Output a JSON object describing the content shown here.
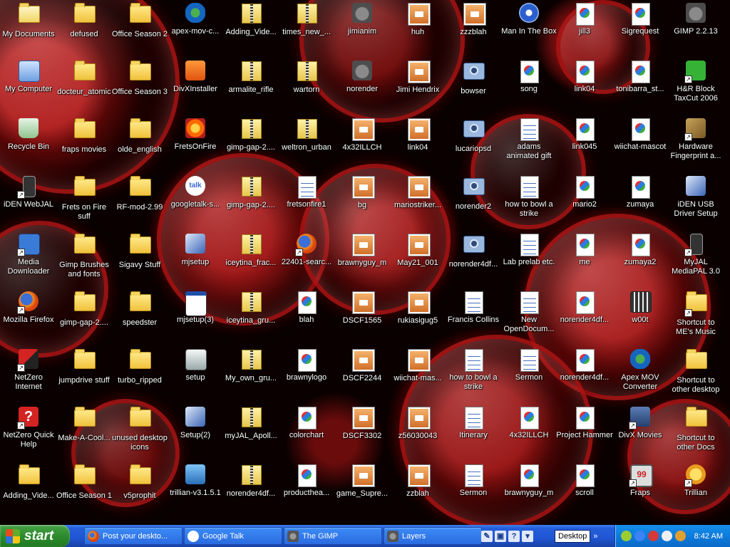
{
  "desktop": {
    "icons": [
      {
        "label": "My Documents",
        "type": "mydocs",
        "col": 0,
        "row": 0
      },
      {
        "label": "defused",
        "type": "folder",
        "col": 1,
        "row": 0
      },
      {
        "label": "Office Season 2",
        "type": "folder",
        "col": 2,
        "row": 0
      },
      {
        "label": "apex-mov-c...",
        "type": "apex",
        "col": 3,
        "row": 0
      },
      {
        "label": "Adding_Vide...",
        "type": "zip",
        "col": 4,
        "row": 0
      },
      {
        "label": "times_new_...",
        "type": "zip",
        "col": 5,
        "row": 0
      },
      {
        "label": "jimianim",
        "type": "gimp",
        "col": 6,
        "row": 0
      },
      {
        "label": "huh",
        "type": "gimpimg",
        "col": 7,
        "row": 0
      },
      {
        "label": "zzzblah",
        "type": "gimpimg",
        "col": 8,
        "row": 0
      },
      {
        "label": "Man In The Box",
        "type": "media",
        "col": 9,
        "row": 0
      },
      {
        "label": "jill3",
        "type": "doc",
        "col": 10,
        "row": 0
      },
      {
        "label": "Sigrequest",
        "type": "doc",
        "col": 11,
        "row": 0
      },
      {
        "label": "GIMP 2.2.13",
        "type": "gimp",
        "col": 12,
        "row": 0
      },
      {
        "label": "My Computer",
        "type": "mycomp",
        "col": 0,
        "row": 1
      },
      {
        "label": "docteur_atomic",
        "type": "folder",
        "col": 1,
        "row": 1
      },
      {
        "label": "Office Season 3",
        "type": "folder",
        "col": 2,
        "row": 1
      },
      {
        "label": "DivXInstaller",
        "type": "divx",
        "col": 3,
        "row": 1
      },
      {
        "label": "armalite_rifle",
        "type": "zip",
        "col": 4,
        "row": 1
      },
      {
        "label": "wartorn",
        "type": "zip",
        "col": 5,
        "row": 1
      },
      {
        "label": "norender",
        "type": "gimp",
        "col": 6,
        "row": 1
      },
      {
        "label": "Jimi Hendrix",
        "type": "gimpimg",
        "col": 7,
        "row": 1
      },
      {
        "label": "bowser",
        "type": "cam",
        "col": 8,
        "row": 1
      },
      {
        "label": "song",
        "type": "mp3",
        "col": 9,
        "row": 1
      },
      {
        "label": "link04",
        "type": "doc",
        "col": 10,
        "row": 1
      },
      {
        "label": "tonibarra_st...",
        "type": "doc",
        "col": 11,
        "row": 1
      },
      {
        "label": "H&R Block TaxCut 2006",
        "type": "hrblock",
        "col": 12,
        "row": 1
      },
      {
        "label": "Recycle Bin",
        "type": "recycle",
        "col": 0,
        "row": 2
      },
      {
        "label": "fraps movies",
        "type": "folder",
        "col": 1,
        "row": 2
      },
      {
        "label": "olde_english",
        "type": "folder",
        "col": 2,
        "row": 2
      },
      {
        "label": "FretsOnFire",
        "type": "frets",
        "col": 3,
        "row": 2
      },
      {
        "label": "gimp-gap-2....",
        "type": "zip",
        "col": 4,
        "row": 2
      },
      {
        "label": "weltron_urban",
        "type": "zip",
        "col": 5,
        "row": 2
      },
      {
        "label": "4x32ILLCH",
        "type": "gimpimg",
        "col": 6,
        "row": 2
      },
      {
        "label": "link04",
        "type": "gimpimg",
        "col": 7,
        "row": 2
      },
      {
        "label": "lucariopsd",
        "type": "cam",
        "col": 8,
        "row": 2
      },
      {
        "label": "adams animated gift",
        "type": "textdoc",
        "col": 9,
        "row": 2
      },
      {
        "label": "link045",
        "type": "doc",
        "col": 10,
        "row": 2
      },
      {
        "label": "wiichat-mascot",
        "type": "doc",
        "col": 11,
        "row": 2
      },
      {
        "label": "Hardware Fingerprint a...",
        "type": "tools",
        "col": 12,
        "row": 2
      },
      {
        "label": "iDEN WebJAL",
        "type": "phone",
        "col": 0,
        "row": 3
      },
      {
        "label": "Frets on Fire suff",
        "type": "folder",
        "col": 1,
        "row": 3
      },
      {
        "label": "RF-mod-2.99",
        "type": "folder",
        "col": 2,
        "row": 3
      },
      {
        "label": "googletalk-s...",
        "type": "talk",
        "col": 3,
        "row": 3
      },
      {
        "label": "gimp-gap-2....",
        "type": "zip",
        "col": 4,
        "row": 3
      },
      {
        "label": "fretsonfire1",
        "type": "textdoc",
        "col": 5,
        "row": 3
      },
      {
        "label": "bg",
        "type": "gimpimg",
        "col": 6,
        "row": 3
      },
      {
        "label": "mariostriker...",
        "type": "gimpimg",
        "col": 7,
        "row": 3
      },
      {
        "label": "norender2",
        "type": "cam",
        "col": 8,
        "row": 3
      },
      {
        "label": "how to bowl a strike",
        "type": "textdoc",
        "col": 9,
        "row": 3
      },
      {
        "label": "mario2",
        "type": "doc",
        "col": 10,
        "row": 3
      },
      {
        "label": "zumaya",
        "type": "doc",
        "col": 11,
        "row": 3
      },
      {
        "label": "iDEN USB Driver Setup",
        "type": "installer",
        "col": 12,
        "row": 3
      },
      {
        "label": "Media Downloader",
        "type": "motorola",
        "col": 0,
        "row": 4
      },
      {
        "label": "Gimp Brushes and fonts",
        "type": "folder",
        "col": 1,
        "row": 4
      },
      {
        "label": "Sigavy Stuff",
        "type": "folder",
        "col": 2,
        "row": 4
      },
      {
        "label": "mjsetup",
        "type": "installer",
        "col": 3,
        "row": 4
      },
      {
        "label": "iceytina_frac...",
        "type": "zip",
        "col": 4,
        "row": 4
      },
      {
        "label": "22401-searc...",
        "type": "firefox",
        "col": 5,
        "row": 4
      },
      {
        "label": "brawnyguy_m",
        "type": "gimpimg",
        "col": 6,
        "row": 4
      },
      {
        "label": "May21_001",
        "type": "gimpimg",
        "col": 7,
        "row": 4
      },
      {
        "label": "norender4df...",
        "type": "cam",
        "col": 8,
        "row": 4
      },
      {
        "label": "Lab prelab etc.",
        "type": "textdoc",
        "col": 9,
        "row": 4
      },
      {
        "label": "me",
        "type": "doc",
        "col": 10,
        "row": 4
      },
      {
        "label": "zumaya2",
        "type": "doc",
        "col": 11,
        "row": 4
      },
      {
        "label": "MyJAL MediaPAL 3.0",
        "type": "phone",
        "col": 12,
        "row": 4
      },
      {
        "label": "Mozilla Firefox",
        "type": "firefox",
        "col": 0,
        "row": 5
      },
      {
        "label": "gimp-gap-2....",
        "type": "folder",
        "col": 1,
        "row": 5
      },
      {
        "label": "speedster",
        "type": "folder",
        "col": 2,
        "row": 5
      },
      {
        "label": "mjsetup(3)",
        "type": "window",
        "col": 3,
        "row": 5
      },
      {
        "label": "iceytina_gru...",
        "type": "zip",
        "col": 4,
        "row": 5
      },
      {
        "label": "blah",
        "type": "doc",
        "col": 5,
        "row": 5
      },
      {
        "label": "DSCF1565",
        "type": "gimpimg",
        "col": 6,
        "row": 5
      },
      {
        "label": "rukiasigug5",
        "type": "gimpimg",
        "col": 7,
        "row": 5
      },
      {
        "label": "Francis Collins",
        "type": "textdoc",
        "col": 8,
        "row": 5
      },
      {
        "label": "New OpenDocum...",
        "type": "textdoc",
        "col": 9,
        "row": 5
      },
      {
        "label": "norender4df...",
        "type": "doc",
        "col": 10,
        "row": 5
      },
      {
        "label": "w00t",
        "type": "video",
        "col": 11,
        "row": 5
      },
      {
        "label": "Shortcut to ME's Music",
        "type": "musicfolder",
        "col": 12,
        "row": 5
      },
      {
        "label": "NetZero Internet",
        "type": "netzero",
        "col": 0,
        "row": 6
      },
      {
        "label": "jumpdrive stuff",
        "type": "folder",
        "col": 1,
        "row": 6
      },
      {
        "label": "turbo_ripped",
        "type": "folder",
        "col": 2,
        "row": 6
      },
      {
        "label": "setup",
        "type": "installer2",
        "col": 3,
        "row": 6
      },
      {
        "label": "My_own_gru...",
        "type": "zip",
        "col": 4,
        "row": 6
      },
      {
        "label": "brawnylogo",
        "type": "doc",
        "col": 5,
        "row": 6
      },
      {
        "label": "DSCF2244",
        "type": "gimpimg",
        "col": 6,
        "row": 6
      },
      {
        "label": "wiichat-mas...",
        "type": "gimpimg",
        "col": 7,
        "row": 6
      },
      {
        "label": "how to bowl a strike",
        "type": "textdoc",
        "col": 8,
        "row": 6
      },
      {
        "label": "Sermon",
        "type": "textdoc",
        "col": 9,
        "row": 6
      },
      {
        "label": "norender4df...",
        "type": "doc",
        "col": 10,
        "row": 6
      },
      {
        "label": "Apex MOV Converter",
        "type": "apex",
        "col": 11,
        "row": 6
      },
      {
        "label": "Shortcut to other desktop",
        "type": "folder",
        "col": 12,
        "row": 6
      },
      {
        "label": "NetZero Quick Help",
        "type": "help",
        "col": 0,
        "row": 7
      },
      {
        "label": "Make-A-Cool...",
        "type": "folder",
        "col": 1,
        "row": 7
      },
      {
        "label": "unused desktop icons",
        "type": "folder",
        "col": 2,
        "row": 7
      },
      {
        "label": "Setup(2)",
        "type": "installer",
        "col": 3,
        "row": 7
      },
      {
        "label": "myJAL_Apoll...",
        "type": "zip",
        "col": 4,
        "row": 7
      },
      {
        "label": "colorchart",
        "type": "doc",
        "col": 5,
        "row": 7
      },
      {
        "label": "DSCF3302",
        "type": "gimpimg",
        "col": 6,
        "row": 7
      },
      {
        "label": "z56030043",
        "type": "gimpimg",
        "col": 7,
        "row": 7
      },
      {
        "label": "Itinerary",
        "type": "textdoc",
        "col": 8,
        "row": 7
      },
      {
        "label": "4x32ILLCH",
        "type": "doc",
        "col": 9,
        "row": 7
      },
      {
        "label": "Project Hammer",
        "type": "doc",
        "col": 10,
        "row": 7
      },
      {
        "label": "DivX Movies",
        "type": "divxmovie",
        "col": 11,
        "row": 7
      },
      {
        "label": "Shortcut to other Docs",
        "type": "folder",
        "col": 12,
        "row": 7
      },
      {
        "label": "Adding_Vide...",
        "type": "folder",
        "col": 0,
        "row": 8
      },
      {
        "label": "Office Season 1",
        "type": "folder",
        "col": 1,
        "row": 8
      },
      {
        "label": "v5prophit",
        "type": "folder",
        "col": 2,
        "row": 8
      },
      {
        "label": "trillian-v3.1.5.1",
        "type": "trillianinst",
        "col": 3,
        "row": 8
      },
      {
        "label": "norender4df...",
        "type": "zip",
        "col": 4,
        "row": 8
      },
      {
        "label": "productheа...",
        "type": "doc",
        "col": 5,
        "row": 8
      },
      {
        "label": "game_Supre...",
        "type": "gimpimg",
        "col": 6,
        "row": 8
      },
      {
        "label": "zzblah",
        "type": "gimpimg",
        "col": 7,
        "row": 8
      },
      {
        "label": "Sermon",
        "type": "textdoc",
        "col": 8,
        "row": 8
      },
      {
        "label": "brawnyguy_m",
        "type": "doc",
        "col": 9,
        "row": 8
      },
      {
        "label": "scroll",
        "type": "doc",
        "col": 10,
        "row": 8
      },
      {
        "label": "Fraps",
        "type": "fraps",
        "col": 11,
        "row": 8
      },
      {
        "label": "Trillian",
        "type": "trillian",
        "col": 12,
        "row": 8
      }
    ]
  },
  "taskbar": {
    "start_label": "start",
    "tasks": [
      {
        "label": "Post your deskto...",
        "icon": "firefox"
      },
      {
        "label": "Google Talk",
        "icon": "talk"
      },
      {
        "label": "The GIMP",
        "icon": "gimp"
      },
      {
        "label": "Layers",
        "icon": "gimp"
      }
    ],
    "quicklaunch": [
      "wrench-icon",
      "monitor-icon",
      "help-icon",
      "arrow-icon"
    ],
    "deskbar_label": "Desktop",
    "clock": "8:42 AM"
  },
  "colors": {
    "taskbar_blue": "#245edb",
    "start_green": "#2d8b2d",
    "tray_blue": "#0e7bda"
  }
}
